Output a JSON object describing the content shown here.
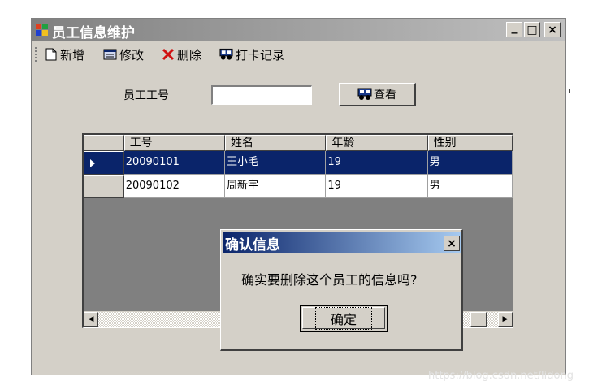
{
  "window": {
    "title": "员工信息维护",
    "controls": {
      "minimize": "_",
      "maximize": "□",
      "close": "×"
    }
  },
  "toolbar": {
    "new_label": "新增",
    "edit_label": "修改",
    "delete_label": "删除",
    "attendance_label": "打卡记录"
  },
  "search": {
    "label": "员工工号",
    "value": "",
    "button_label": "查看"
  },
  "grid": {
    "columns": [
      "工号",
      "姓名",
      "年龄",
      "性别"
    ],
    "rows": [
      {
        "id": "20090101",
        "name": "王小毛",
        "age": "19",
        "gender": "男",
        "selected": true
      },
      {
        "id": "20090102",
        "name": "周新宇",
        "age": "19",
        "gender": "男",
        "selected": false
      }
    ]
  },
  "dialog": {
    "title": "确认信息",
    "message": "确实要删除这个员工的信息吗?",
    "ok_label": "确定"
  },
  "watermark": "https://blog.csdn.net/lidong"
}
